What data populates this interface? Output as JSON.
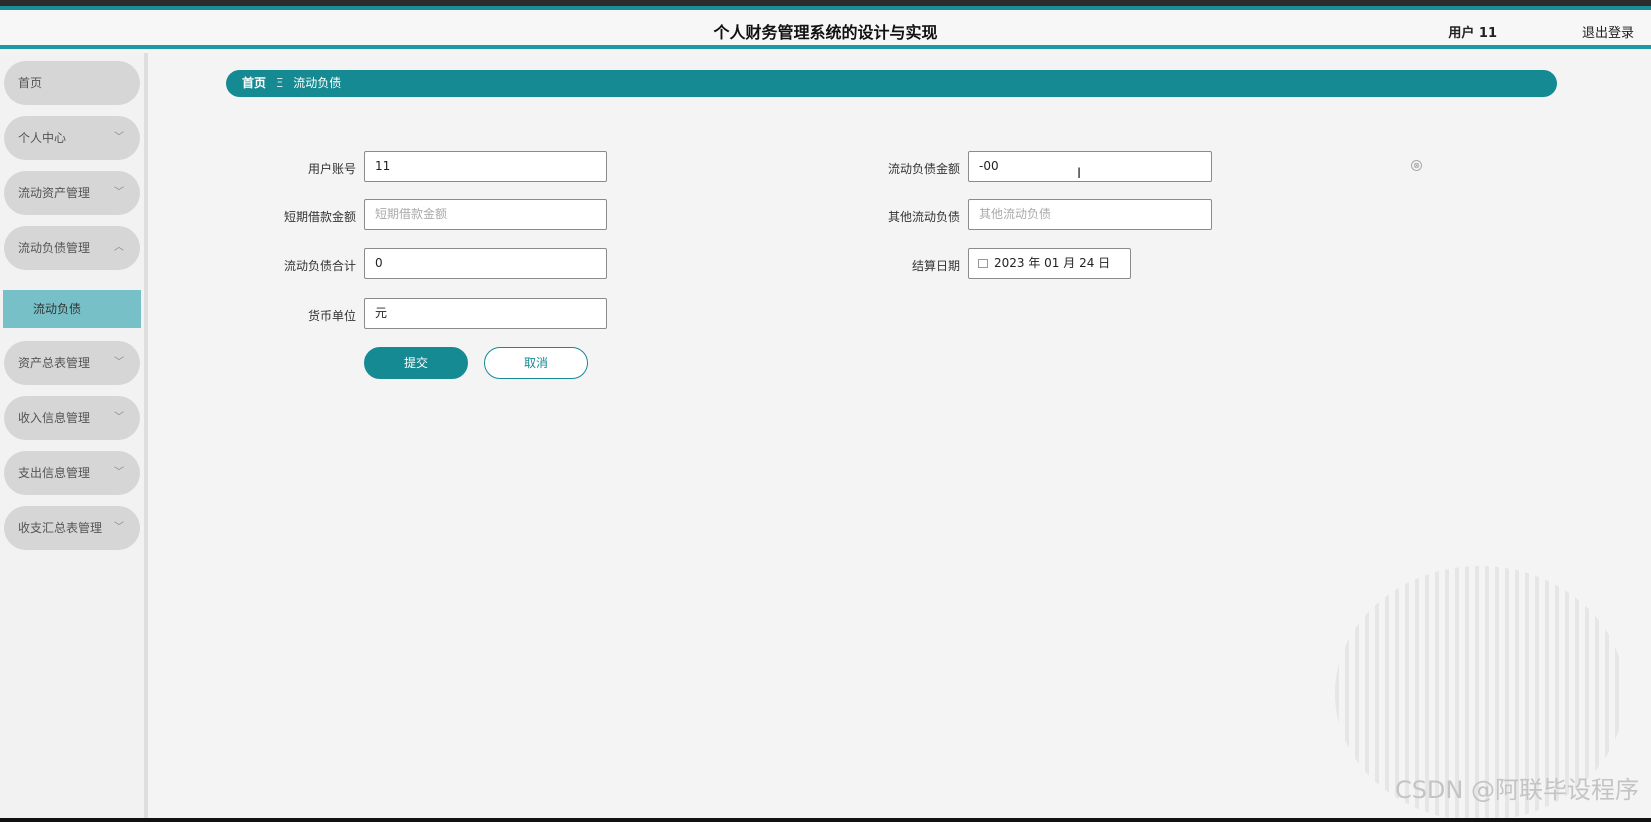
{
  "header": {
    "title": "个人财务管理系统的设计与实现",
    "user": "用户 11",
    "logout": "退出登录"
  },
  "sidebar": {
    "items": [
      {
        "label": "首页",
        "chevron": ""
      },
      {
        "label": "个人中心",
        "chevron": "﹀"
      },
      {
        "label": "流动资产管理",
        "chevron": "﹀"
      },
      {
        "label": "流动负债管理",
        "chevron": "︿"
      },
      {
        "label": "资产总表管理",
        "chevron": "﹀"
      },
      {
        "label": "收入信息管理",
        "chevron": "﹀"
      },
      {
        "label": "支出信息管理",
        "chevron": "﹀"
      },
      {
        "label": "收支汇总表管理",
        "chevron": "﹀"
      }
    ],
    "active_sub": "流动负债"
  },
  "breadcrumb": {
    "home": "首页",
    "separator": "Ξ",
    "current": "流动负债"
  },
  "form": {
    "account_label": "用户账号",
    "account_value": "11",
    "amount_label": "流动负债金额",
    "amount_value": "-00",
    "short_loan_label": "短期借款金额",
    "short_loan_placeholder": "短期借款金额",
    "other_label": "其他流动负债",
    "other_placeholder": "其他流动负债",
    "total_label": "流动负债合计",
    "total_value": "0",
    "date_label": "结算日期",
    "date_value": "2023 年 01 月 24 日",
    "currency_label": "货币单位",
    "currency_value": "元",
    "submit": "提交",
    "cancel": "取消"
  },
  "icons": {
    "clear": "⊗",
    "text_cursor": "I"
  },
  "watermark": "CSDN @阿联毕设程序",
  "colors": {
    "accent": "#168a92",
    "active_sub_bg": "#77c0c8",
    "menu_bg": "#d6d6d6"
  }
}
